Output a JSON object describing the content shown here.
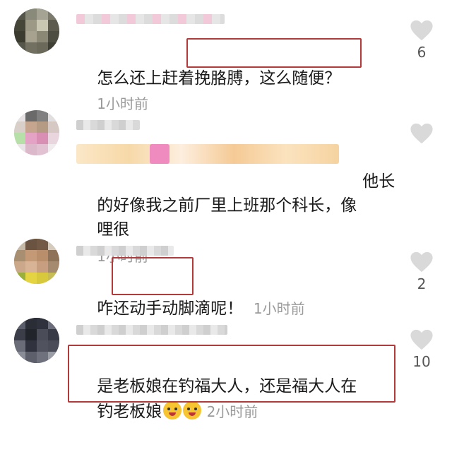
{
  "comments": [
    {
      "text": "怎么还上赶着挽胳膊，这么随便？",
      "time": "1小时前",
      "likes": "6"
    },
    {
      "text_line1": "他长",
      "text_line2": "的好像我之前厂里上班那个科长，像",
      "text_line3": "哩很",
      "time": "1小时前",
      "likes": ""
    },
    {
      "text": "咋还动手动脚滴呢！",
      "time": "1小时前",
      "likes": "2"
    },
    {
      "text_line1": "是老板娘在钓福大人，还是福大人在",
      "text_line2": "钓老板娘",
      "emoji": "laughing-crying-emoji",
      "time": "2小时前",
      "likes": "10"
    }
  ],
  "colors": {
    "highlight": "#b23a3a",
    "time": "#9a9a9a",
    "heart": "#d9d9d9"
  },
  "icons": {
    "like": "heart-icon"
  }
}
